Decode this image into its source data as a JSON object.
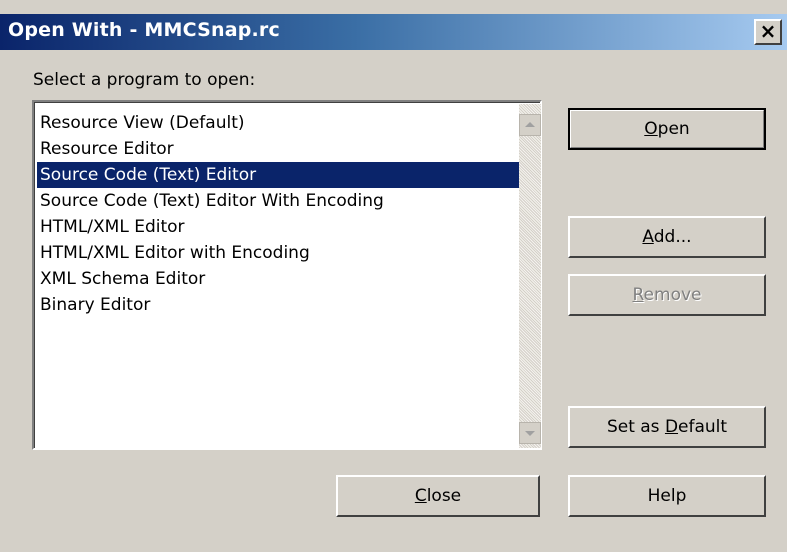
{
  "window": {
    "title": "Open With - MMCSnap.rc",
    "close_glyph": "×"
  },
  "prompt": "Select a program to open:",
  "programs": {
    "items": [
      {
        "label": "Resource View (Default)",
        "selected": false
      },
      {
        "label": "Resource Editor",
        "selected": false
      },
      {
        "label": "Source Code (Text) Editor",
        "selected": true
      },
      {
        "label": "Source Code (Text) Editor With Encoding",
        "selected": false
      },
      {
        "label": "HTML/XML Editor",
        "selected": false
      },
      {
        "label": "HTML/XML Editor with Encoding",
        "selected": false
      },
      {
        "label": "XML Schema Editor",
        "selected": false
      },
      {
        "label": "Binary Editor",
        "selected": false
      }
    ]
  },
  "buttons": {
    "open": {
      "pre": "",
      "acc": "O",
      "post": "pen",
      "enabled": true
    },
    "add": {
      "pre": "",
      "acc": "A",
      "post": "dd...",
      "enabled": true
    },
    "remove": {
      "pre": "",
      "acc": "R",
      "post": "emove",
      "enabled": false
    },
    "set_default": {
      "pre": "Set as ",
      "acc": "D",
      "post": "efault",
      "enabled": true
    },
    "close": {
      "pre": "",
      "acc": "C",
      "post": "lose",
      "enabled": true
    },
    "help": {
      "pre": "Help",
      "acc": "",
      "post": "",
      "enabled": true
    }
  },
  "icons": {
    "scroll_up": "scroll-up-arrow-icon",
    "scroll_down": "scroll-down-arrow-icon",
    "close": "close-icon"
  },
  "colors": {
    "selection": "#0a246a",
    "dialog_face": "#d4d0c8",
    "title_gradient_start": "#0a246a",
    "title_gradient_end": "#a6caf0"
  }
}
